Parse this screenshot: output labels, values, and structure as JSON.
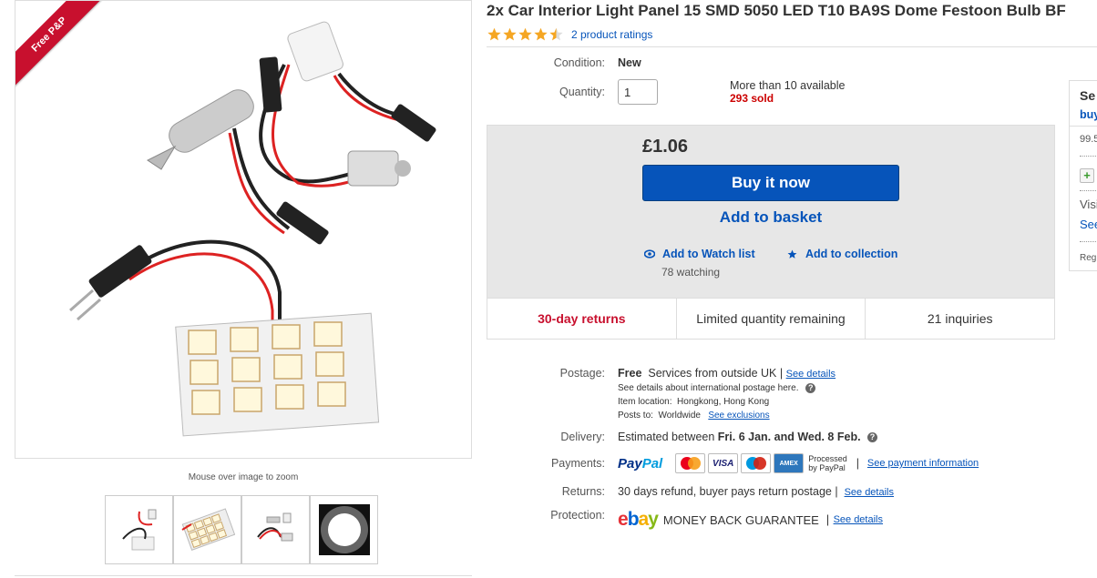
{
  "gallery": {
    "ribbon": "Free P&P",
    "zoom_hint": "Mouse over image to zoom",
    "thumbnails": [
      "thumbnail-led-kit",
      "thumbnail-led-panel",
      "thumbnail-adapters",
      "thumbnail-lit-led"
    ]
  },
  "item": {
    "title": "2x Car Interior Light Panel 15 SMD 5050 LED T10 BA9S Dome Festoon Bulb BF",
    "rating_stars": 4.5,
    "rating_link": "2 product ratings",
    "condition_label": "Condition:",
    "condition_value": "New",
    "quantity_label": "Quantity:",
    "quantity_value": "1",
    "availability": "More than 10 available",
    "sold": "293 sold"
  },
  "buy": {
    "price": "£1.06",
    "buy_now": "Buy it now",
    "add_basket": "Add to basket",
    "watch_list": "Add to Watch list",
    "watching": "78 watching",
    "collection": "Add to collection"
  },
  "stats": {
    "returns": "30-day returns",
    "limited": "Limited quantity remaining",
    "inquiries": "21 inquiries"
  },
  "postage": {
    "label": "Postage:",
    "free": "Free",
    "service": "Services from outside UK",
    "pipe": "|",
    "see_details": "See details",
    "intl": "See details about international postage here.",
    "location_label": "Item location:",
    "location": "Hongkong, Hong Kong",
    "posts_to_label": "Posts to:",
    "posts_to": "Worldwide",
    "exclusions": "See exclusions"
  },
  "delivery": {
    "label": "Delivery:",
    "prefix": "Estimated between",
    "range": "Fri. 6 Jan. and Wed. 8 Feb."
  },
  "payments": {
    "label": "Payments:",
    "paypal_a": "Pay",
    "paypal_b": "Pal",
    "cards": [
      "MasterCard",
      "VISA",
      "Maestro",
      "AMEX"
    ],
    "processed_1": "Processed",
    "processed_2": "by PayPal",
    "pipe": "|",
    "link": "See payment information"
  },
  "returns": {
    "label": "Returns:",
    "text": "30 days refund, buyer pays return postage",
    "pipe": "|",
    "link": "See details"
  },
  "protection": {
    "label": "Protection:",
    "ebay": [
      "e",
      "b",
      "a",
      "y"
    ],
    "ebay_colors": [
      "#e53238",
      "#0064d2",
      "#f5af02",
      "#86b817"
    ],
    "guarantee": "MONEY BACK GUARANTEE",
    "pipe": "|",
    "link": "See details"
  },
  "seller": {
    "heading": "Se",
    "name": "buy",
    "percent": "99.5",
    "visit": "Visi",
    "see": "See",
    "reg": "Reg"
  },
  "colors": {
    "accent": "#0654ba",
    "red": "#c8102e",
    "star": "#f5a623"
  }
}
